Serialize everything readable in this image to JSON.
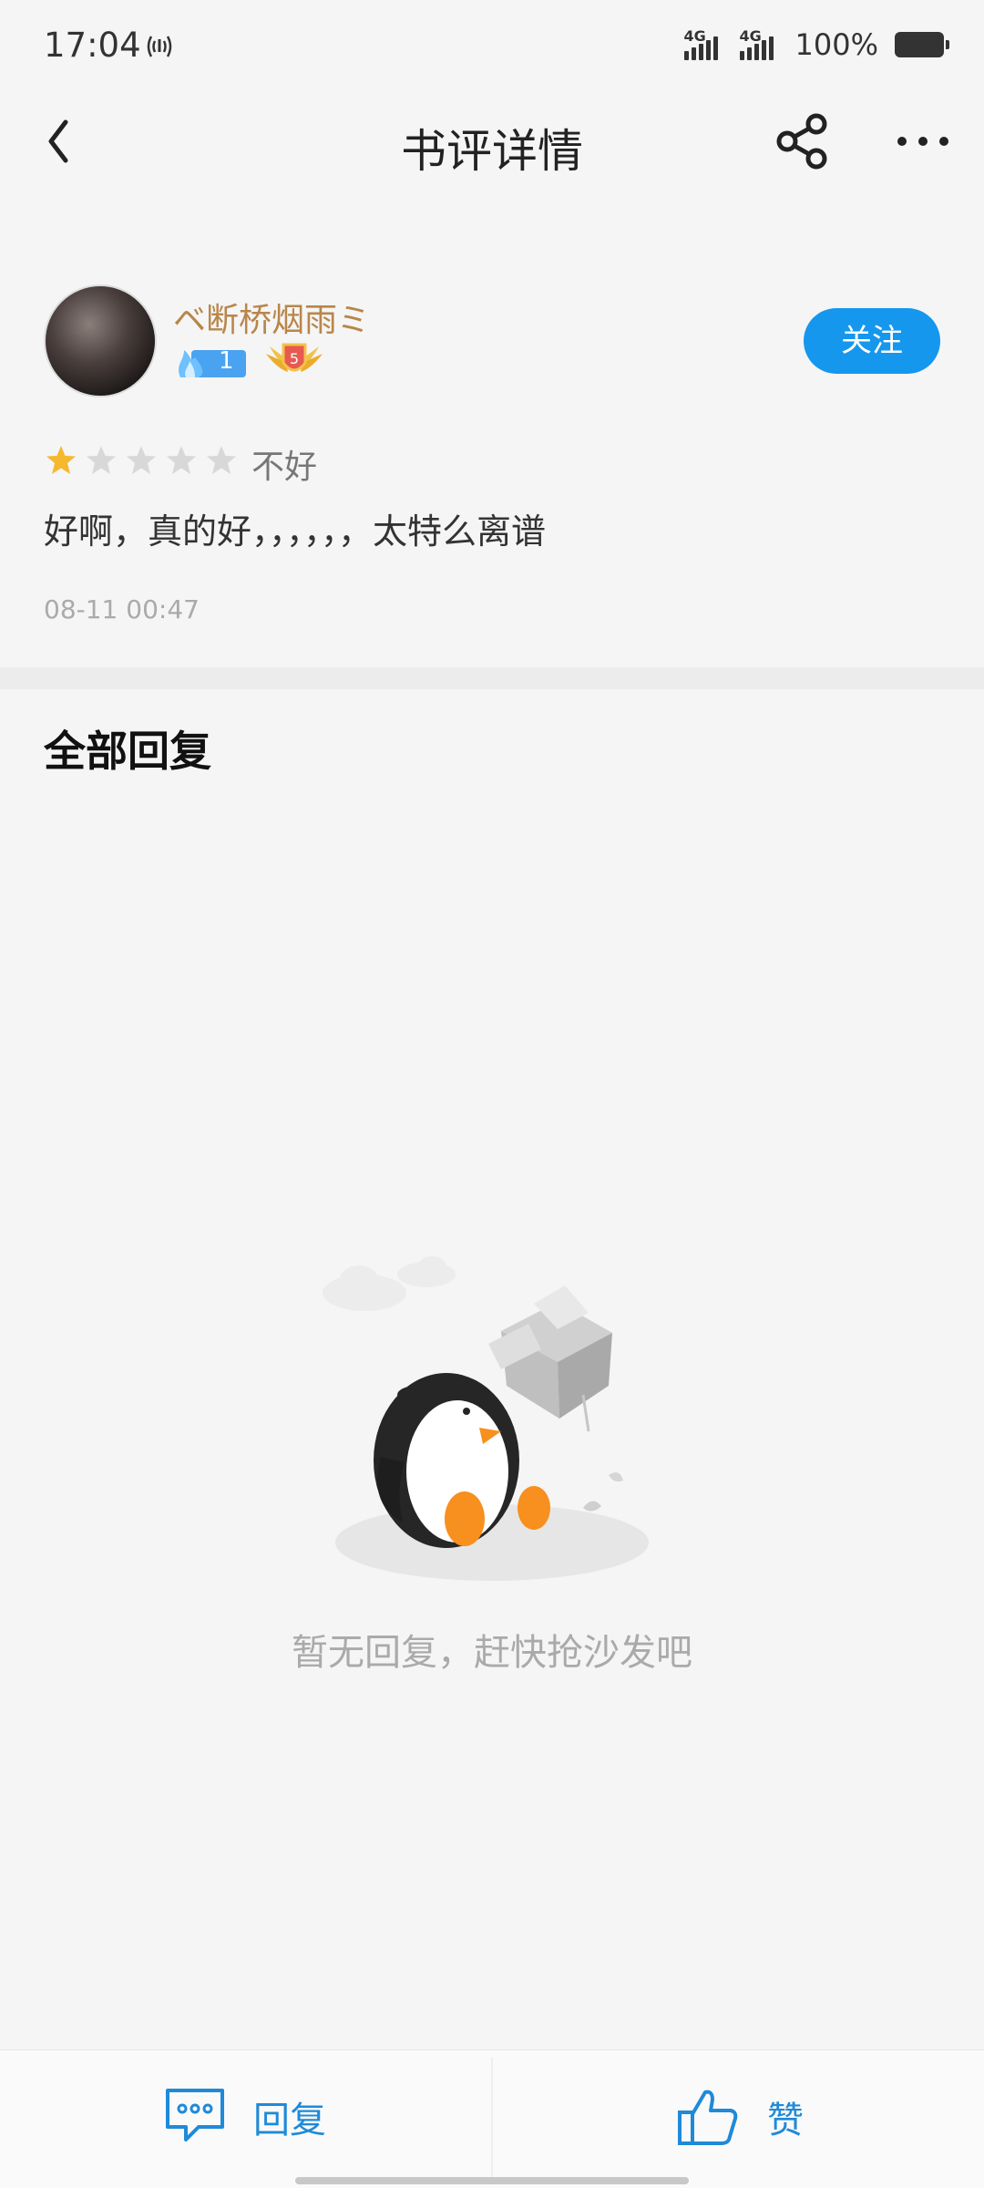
{
  "status_bar": {
    "time": "17:04",
    "network_1": "4G",
    "network_2": "4G",
    "battery": "100%"
  },
  "nav": {
    "title": "书评详情"
  },
  "review": {
    "username": "ベ断桥烟雨ミ",
    "fire_level": "1",
    "medal_level": "5",
    "follow_label": "关注",
    "rating": 1,
    "rating_max": 5,
    "rating_label": "不好",
    "content": "好啊，真的好，，，，，，太特么离谱",
    "time": "08-11 00:47"
  },
  "replies": {
    "section_title": "全部回复",
    "empty_text": "暂无回复，赶快抢沙发吧"
  },
  "bottom_bar": {
    "reply_label": "回复",
    "like_label": "赞"
  },
  "colors": {
    "accent": "#1597ee",
    "username": "#b8864a",
    "star_on": "#f5b82e",
    "star_off": "#d8d8d8"
  }
}
